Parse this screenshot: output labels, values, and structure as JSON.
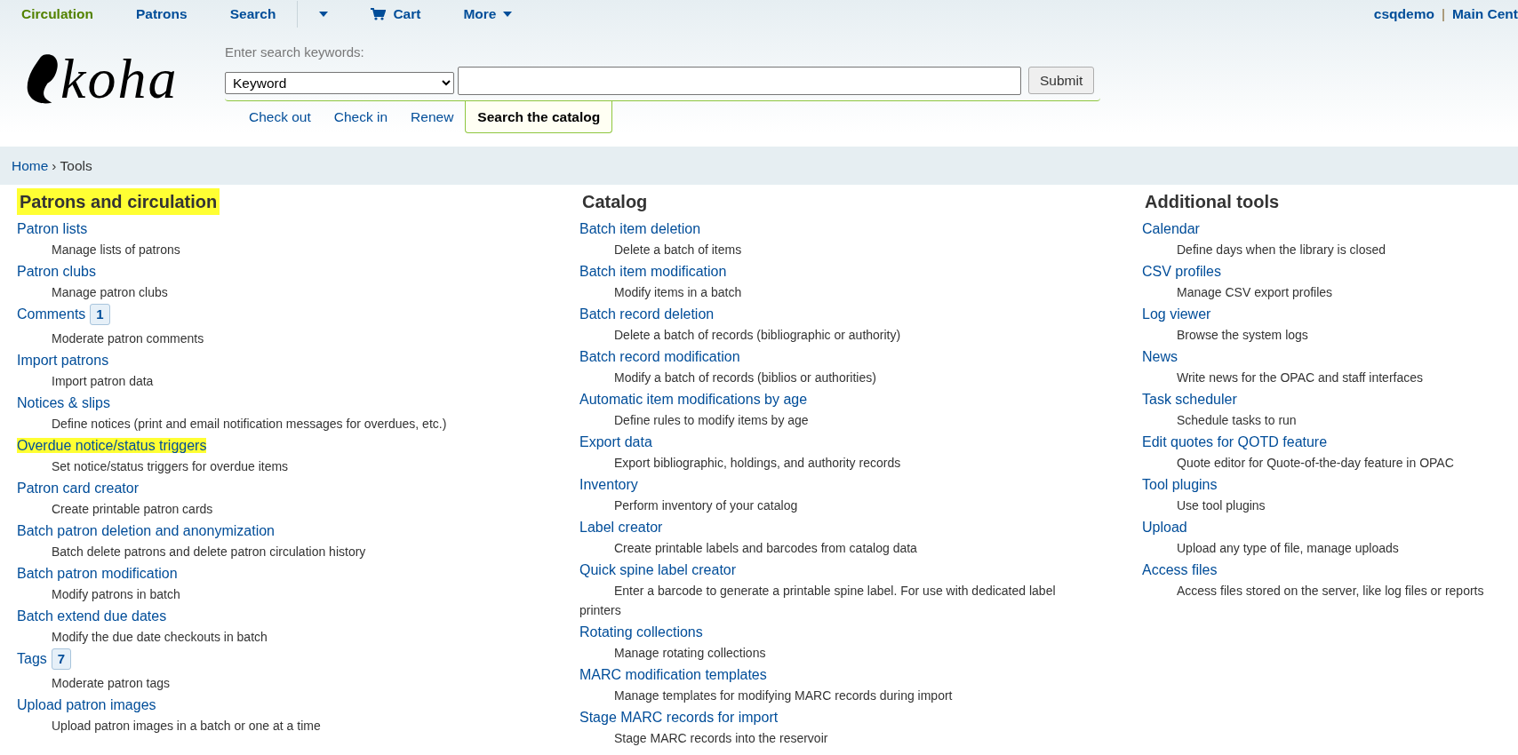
{
  "top_nav": [
    {
      "label": "Circulation",
      "kind": "link",
      "selected": true
    },
    {
      "label": "Patrons",
      "kind": "link",
      "selected": false
    },
    {
      "label": "Search",
      "kind": "link",
      "selected": false
    },
    {
      "kind": "caret",
      "selected": false
    },
    {
      "label": "Cart",
      "kind": "cart",
      "selected": false
    },
    {
      "label": "More",
      "kind": "menu",
      "selected": false
    }
  ],
  "user": {
    "name": "csqdemo",
    "separator": "|",
    "branch": "Main Cent"
  },
  "logo": {
    "text": "koha"
  },
  "search": {
    "label": "Enter search keywords:",
    "select_value": "Keyword",
    "button": "Submit"
  },
  "search_tabs": [
    {
      "label": "Check out",
      "selected": false
    },
    {
      "label": "Check in",
      "selected": false
    },
    {
      "label": "Renew",
      "selected": false
    },
    {
      "label": "Search the catalog",
      "selected": true
    }
  ],
  "breadcrumb": [
    {
      "label": "Home",
      "kind": "link"
    },
    {
      "label": "›",
      "kind": "separator"
    },
    {
      "label": "Tools",
      "kind": "current"
    }
  ],
  "columns": [
    {
      "heading": "Patrons and circulation",
      "highlighted": true,
      "items": [
        {
          "title": "Patron lists",
          "description": "Manage lists of patrons",
          "highlighted": false
        },
        {
          "title": "Patron clubs",
          "description": "Manage patron clubs",
          "highlighted": false
        },
        {
          "title": "Comments",
          "badge": "1",
          "description": "Moderate patron comments",
          "highlighted": false
        },
        {
          "title": "Import patrons",
          "description": "Import patron data",
          "highlighted": false
        },
        {
          "title": "Notices & slips",
          "description": "Define notices (print and email notification messages for overdues, etc.)",
          "highlighted": false
        },
        {
          "title": "Overdue notice/status triggers",
          "description": "Set notice/status triggers for overdue items",
          "highlighted": true
        },
        {
          "title": "Patron card creator",
          "description": "Create printable patron cards",
          "highlighted": false
        },
        {
          "title": "Batch patron deletion and anonymization",
          "description": "Batch delete patrons and delete patron circulation history",
          "highlighted": false
        },
        {
          "title": "Batch patron modification",
          "description": "Modify patrons in batch",
          "highlighted": false
        },
        {
          "title": "Batch extend due dates",
          "description": "Modify the due date checkouts in batch",
          "highlighted": false
        },
        {
          "title": "Tags",
          "badge": "7",
          "description": "Moderate patron tags",
          "highlighted": false
        },
        {
          "title": "Upload patron images",
          "description": "Upload patron images in a batch or one at a time",
          "highlighted": false
        }
      ]
    },
    {
      "heading": "Catalog",
      "highlighted": false,
      "items": [
        {
          "title": "Batch item deletion",
          "description": "Delete a batch of items",
          "highlighted": false
        },
        {
          "title": "Batch item modification",
          "description": "Modify items in a batch",
          "highlighted": false
        },
        {
          "title": "Batch record deletion",
          "description": "Delete a batch of records (bibliographic or authority)",
          "highlighted": false
        },
        {
          "title": "Batch record modification",
          "description": "Modify a batch of records (biblios or authorities)",
          "highlighted": false
        },
        {
          "title": "Automatic item modifications by age",
          "description": "Define rules to modify items by age",
          "highlighted": false
        },
        {
          "title": "Export data",
          "description": "Export bibliographic, holdings, and authority records",
          "highlighted": false
        },
        {
          "title": "Inventory",
          "description": "Perform inventory of your catalog",
          "highlighted": false
        },
        {
          "title": "Label creator",
          "description": "Create printable labels and barcodes from catalog data",
          "highlighted": false
        },
        {
          "title": "Quick spine label creator",
          "description": "Enter a barcode to generate a printable spine label. For use with dedicated label printers",
          "highlighted": false
        },
        {
          "title": "Rotating collections",
          "description": "Manage rotating collections",
          "highlighted": false
        },
        {
          "title": "MARC modification templates",
          "description": "Manage templates for modifying MARC records during import",
          "highlighted": false
        },
        {
          "title": "Stage MARC records for import",
          "description": "Stage MARC records into the reservoir",
          "highlighted": false
        }
      ]
    },
    {
      "heading": "Additional tools",
      "highlighted": false,
      "items": [
        {
          "title": "Calendar",
          "description": "Define days when the library is closed",
          "highlighted": false
        },
        {
          "title": "CSV profiles",
          "description": "Manage CSV export profiles",
          "highlighted": false
        },
        {
          "title": "Log viewer",
          "description": "Browse the system logs",
          "highlighted": false
        },
        {
          "title": "News",
          "description": "Write news for the OPAC and staff interfaces",
          "highlighted": false
        },
        {
          "title": "Task scheduler",
          "description": "Schedule tasks to run",
          "highlighted": false
        },
        {
          "title": "Edit quotes for QOTD feature",
          "description": "Quote editor for Quote-of-the-day feature in OPAC",
          "highlighted": false
        },
        {
          "title": "Tool plugins",
          "description": "Use tool plugins",
          "highlighted": false
        },
        {
          "title": "Upload",
          "description": "Upload any type of file, manage uploads",
          "highlighted": false
        },
        {
          "title": "Access files",
          "description": "Access files stored on the server, like log files or reports",
          "highlighted": false
        }
      ]
    }
  ]
}
